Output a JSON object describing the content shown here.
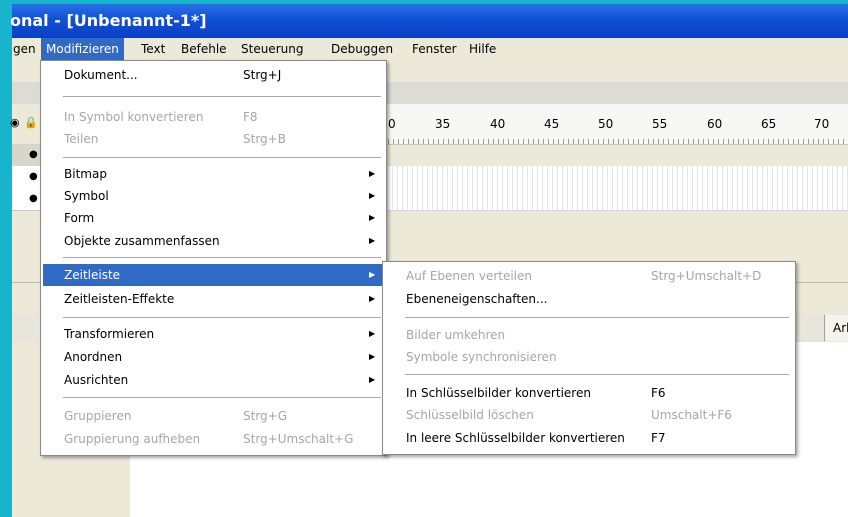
{
  "window": {
    "title": "onal - [Unbenannt-1*]"
  },
  "menubar": {
    "items": [
      "gen",
      "Modifizieren",
      "Text",
      "Befehle",
      "Steuerung",
      "Debuggen",
      "Fenster",
      "Hilfe"
    ]
  },
  "ruler": {
    "numbers": [
      "0",
      "35",
      "40",
      "45",
      "50",
      "55",
      "60",
      "65",
      "70"
    ]
  },
  "panel": {
    "tab_label": "Arb"
  },
  "modify_menu": {
    "items": [
      {
        "label": "Dokument...",
        "shortcut": "Strg+J",
        "enabled": true
      },
      {
        "label": "In Symbol konvertieren",
        "shortcut": "F8",
        "enabled": false
      },
      {
        "label": "Teilen",
        "shortcut": "Strg+B",
        "enabled": false
      },
      {
        "label": "Bitmap",
        "submenu": true,
        "enabled": true
      },
      {
        "label": "Symbol",
        "submenu": true,
        "enabled": true
      },
      {
        "label": "Form",
        "submenu": true,
        "enabled": true
      },
      {
        "label": "Objekte zusammenfassen",
        "submenu": true,
        "enabled": true
      },
      {
        "label": "Zeitleiste",
        "submenu": true,
        "enabled": true,
        "highlighted": true
      },
      {
        "label": "Zeitleisten-Effekte",
        "submenu": true,
        "enabled": true
      },
      {
        "label": "Transformieren",
        "submenu": true,
        "enabled": true
      },
      {
        "label": "Anordnen",
        "submenu": true,
        "enabled": true
      },
      {
        "label": "Ausrichten",
        "submenu": true,
        "enabled": true
      },
      {
        "label": "Gruppieren",
        "shortcut": "Strg+G",
        "enabled": false
      },
      {
        "label": "Gruppierung aufheben",
        "shortcut": "Strg+Umschalt+G",
        "enabled": false
      }
    ]
  },
  "timeline_submenu": {
    "items": [
      {
        "label": "Auf Ebenen verteilen",
        "shortcut": "Strg+Umschalt+D",
        "enabled": false
      },
      {
        "label": "Ebeneneigenschaften...",
        "enabled": true
      },
      {
        "label": "Bilder umkehren",
        "enabled": false
      },
      {
        "label": "Symbole synchronisieren",
        "enabled": false
      },
      {
        "label": "In Schlüsselbilder konvertieren",
        "shortcut": "F6",
        "enabled": true
      },
      {
        "label": "Schlüsselbild löschen",
        "shortcut": "Umschalt+F6",
        "enabled": false
      },
      {
        "label": "In leere Schlüsselbilder konvertieren",
        "shortcut": "F7",
        "enabled": true
      }
    ]
  },
  "colors": {
    "highlight": "#316ac5",
    "titlebar": "#0a3fc4",
    "teal": "#18b4cc"
  }
}
